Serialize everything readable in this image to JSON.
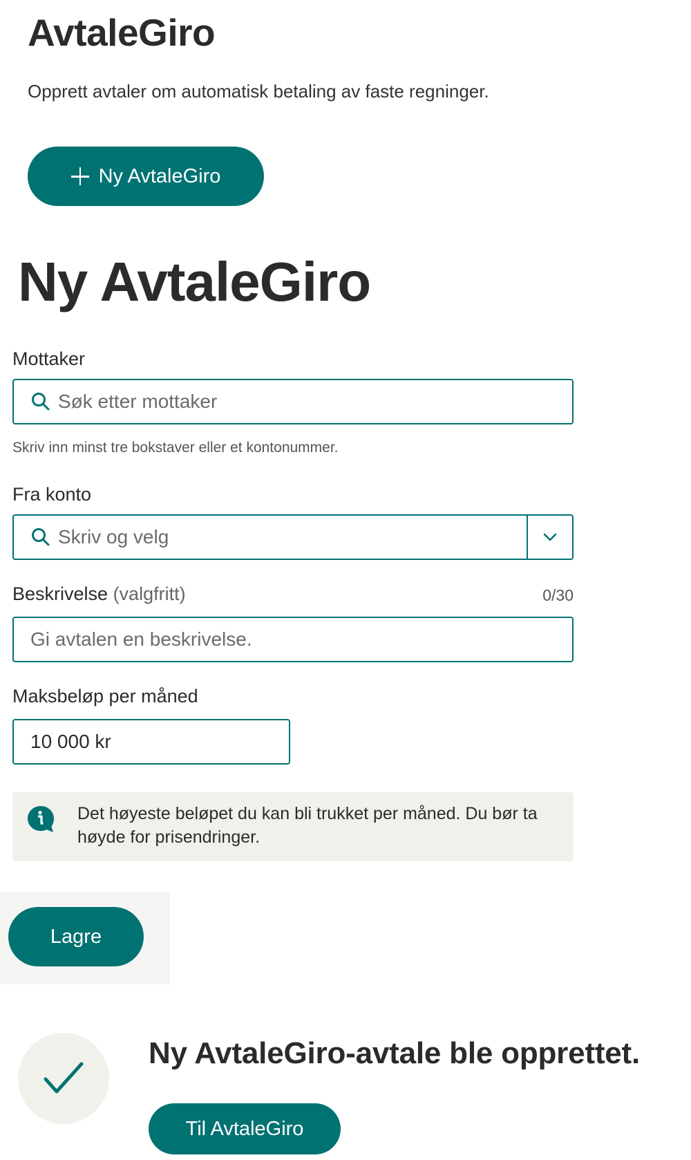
{
  "header": {
    "title": "AvtaleGiro",
    "subtitle": "Opprett avtaler om automatisk betaling av faste regninger.",
    "new_button_label": "Ny AvtaleGiro"
  },
  "form": {
    "title": "Ny AvtaleGiro",
    "recipient": {
      "label": "Mottaker",
      "placeholder": "Søk etter mottaker",
      "hint": "Skriv inn minst tre bokstaver eller et kontonummer."
    },
    "from_account": {
      "label": "Fra konto",
      "placeholder": "Skriv og velg"
    },
    "description": {
      "label": "Beskrivelse",
      "optional_label": "(valgfritt)",
      "counter": "0/30",
      "placeholder": "Gi avtalen en beskrivelse."
    },
    "max_amount": {
      "label": "Maksbeløp per måned",
      "value": "10 000 kr"
    },
    "info_text": "Det høyeste beløpet du kan bli trukket per måned. Du bør ta høyde for prisendringer.",
    "save_label": "Lagre"
  },
  "success": {
    "message": "Ny AvtaleGiro-avtale ble opprettet.",
    "button_label": "Til AvtaleGiro"
  },
  "colors": {
    "accent": "#007272",
    "info_background": "#f1f1ec",
    "text": "#2b2b2b"
  },
  "icons": {
    "new_button": "plus-icon",
    "recipient_field": "search-icon",
    "account_field": "search-icon",
    "dropdown": "chevron-down-icon",
    "info": "info-icon",
    "success": "checkmark-icon"
  }
}
